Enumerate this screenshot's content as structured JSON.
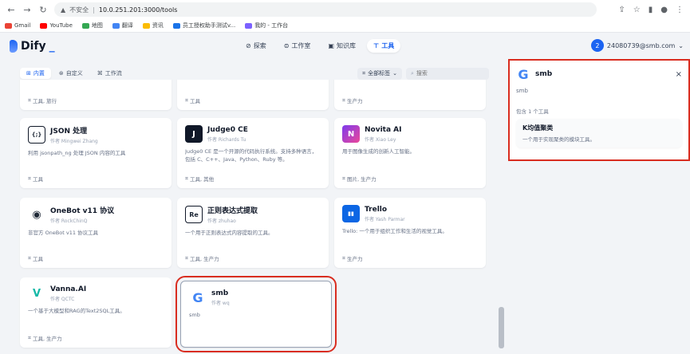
{
  "browser": {
    "url_warning": "不安全",
    "url": "10.0.251.201:3000/tools",
    "bookmarks": [
      "Gmail",
      "YouTube",
      "地图",
      "翻译",
      "资讯",
      "员工授权助手测试v...",
      "我的 - 工作台"
    ],
    "bookmark_colors": [
      "#ea4335",
      "#ff0000",
      "#34a853",
      "#4285f4",
      "#fbbc04",
      "#1a73e8",
      "#7b61ff"
    ]
  },
  "app": {
    "logo": "Dify",
    "nav": [
      {
        "label": "探索",
        "icon": "compass-icon"
      },
      {
        "label": "工作室",
        "icon": "studio-icon"
      },
      {
        "label": "知识库",
        "icon": "book-icon"
      },
      {
        "label": "工具",
        "icon": "tool-icon",
        "active": true
      }
    ],
    "user": {
      "avatar_letter": "2",
      "email": "24080739@smb.com"
    }
  },
  "filters": {
    "tabs": [
      {
        "label": "内置",
        "active": true
      },
      {
        "label": "自定义"
      },
      {
        "label": "工作流"
      }
    ],
    "tag_select": "全部标签",
    "search_placeholder": "搜索"
  },
  "cards": [
    {
      "title": "",
      "author": "",
      "desc": "",
      "tags": "工具, 旅行"
    },
    {
      "title": "",
      "author": "",
      "desc": "",
      "tags": "工具"
    },
    {
      "title": "",
      "author": "",
      "desc": "",
      "tags": "生产力"
    },
    {
      "title": "JSON 处理",
      "author": "作者 Mingwei Zhang",
      "desc": "利用 jsonpath_ng 处理 JSON 内容的工具",
      "tags": "工具",
      "icon": "{;}",
      "icon_bg": "#ffffff",
      "icon_color": "#101828"
    },
    {
      "title": "Judge0 CE",
      "author": "作者 Richards Tu",
      "desc": "Judge0 CE 是一个开源的代码执行系统。支持多种语言，包括 C、C++、Java、Python、Ruby 等。",
      "tags": "工具, 其他",
      "icon": "J",
      "icon_bg": "#101828",
      "icon_color": "#ffffff"
    },
    {
      "title": "Novita AI",
      "author": "作者 Xiao Ley",
      "desc": "用于图像生成的创新人工智能。",
      "tags": "图片, 生产力",
      "icon": "N",
      "icon_bg": "#7c3aed",
      "icon_color": "#ffffff"
    },
    {
      "title": "OneBot v11 协议",
      "author": "作者 RockChinQ",
      "desc": "非官方 OneBot v11 协议工具",
      "tags": "工具",
      "icon": "◉",
      "icon_bg": "#ffffff",
      "icon_color": "#101828"
    },
    {
      "title": "正则表达式提取",
      "author": "作者 zhuhao",
      "desc": "一个用于正则表达式内容提取的工具。",
      "tags": "工具, 生产力",
      "icon": "Re",
      "icon_bg": "#ffffff",
      "icon_color": "#101828"
    },
    {
      "title": "Trello",
      "author": "作者 Yash Parmar",
      "desc": "Trello: 一个用于组织工作和生活的视觉工具。",
      "tags": "生产力",
      "icon": "▮▮",
      "icon_bg": "#0c66e4",
      "icon_color": "#ffffff"
    },
    {
      "title": "Vanna.AI",
      "author": "作者 QCTC",
      "desc": "一个基于大模型和RAG的Text2SQL工具。",
      "tags": "工具, 生产力",
      "icon": "V",
      "icon_bg": "#ffffff",
      "icon_color": "#14b8a6"
    },
    {
      "title": "smb",
      "author": "作者 wq",
      "desc": "smb",
      "tags": "",
      "icon": "G",
      "icon_bg": "#ffffff",
      "icon_color": "#4285f4",
      "selected": true
    }
  ],
  "panel": {
    "title": "smb",
    "description": "smb",
    "count_text": "包含 1 个工具",
    "tool": {
      "name": "K均值聚类",
      "desc": "一个用于实现聚类的模块工具。"
    }
  },
  "colors": {
    "accent": "#155eef",
    "highlight": "#d92d20"
  }
}
